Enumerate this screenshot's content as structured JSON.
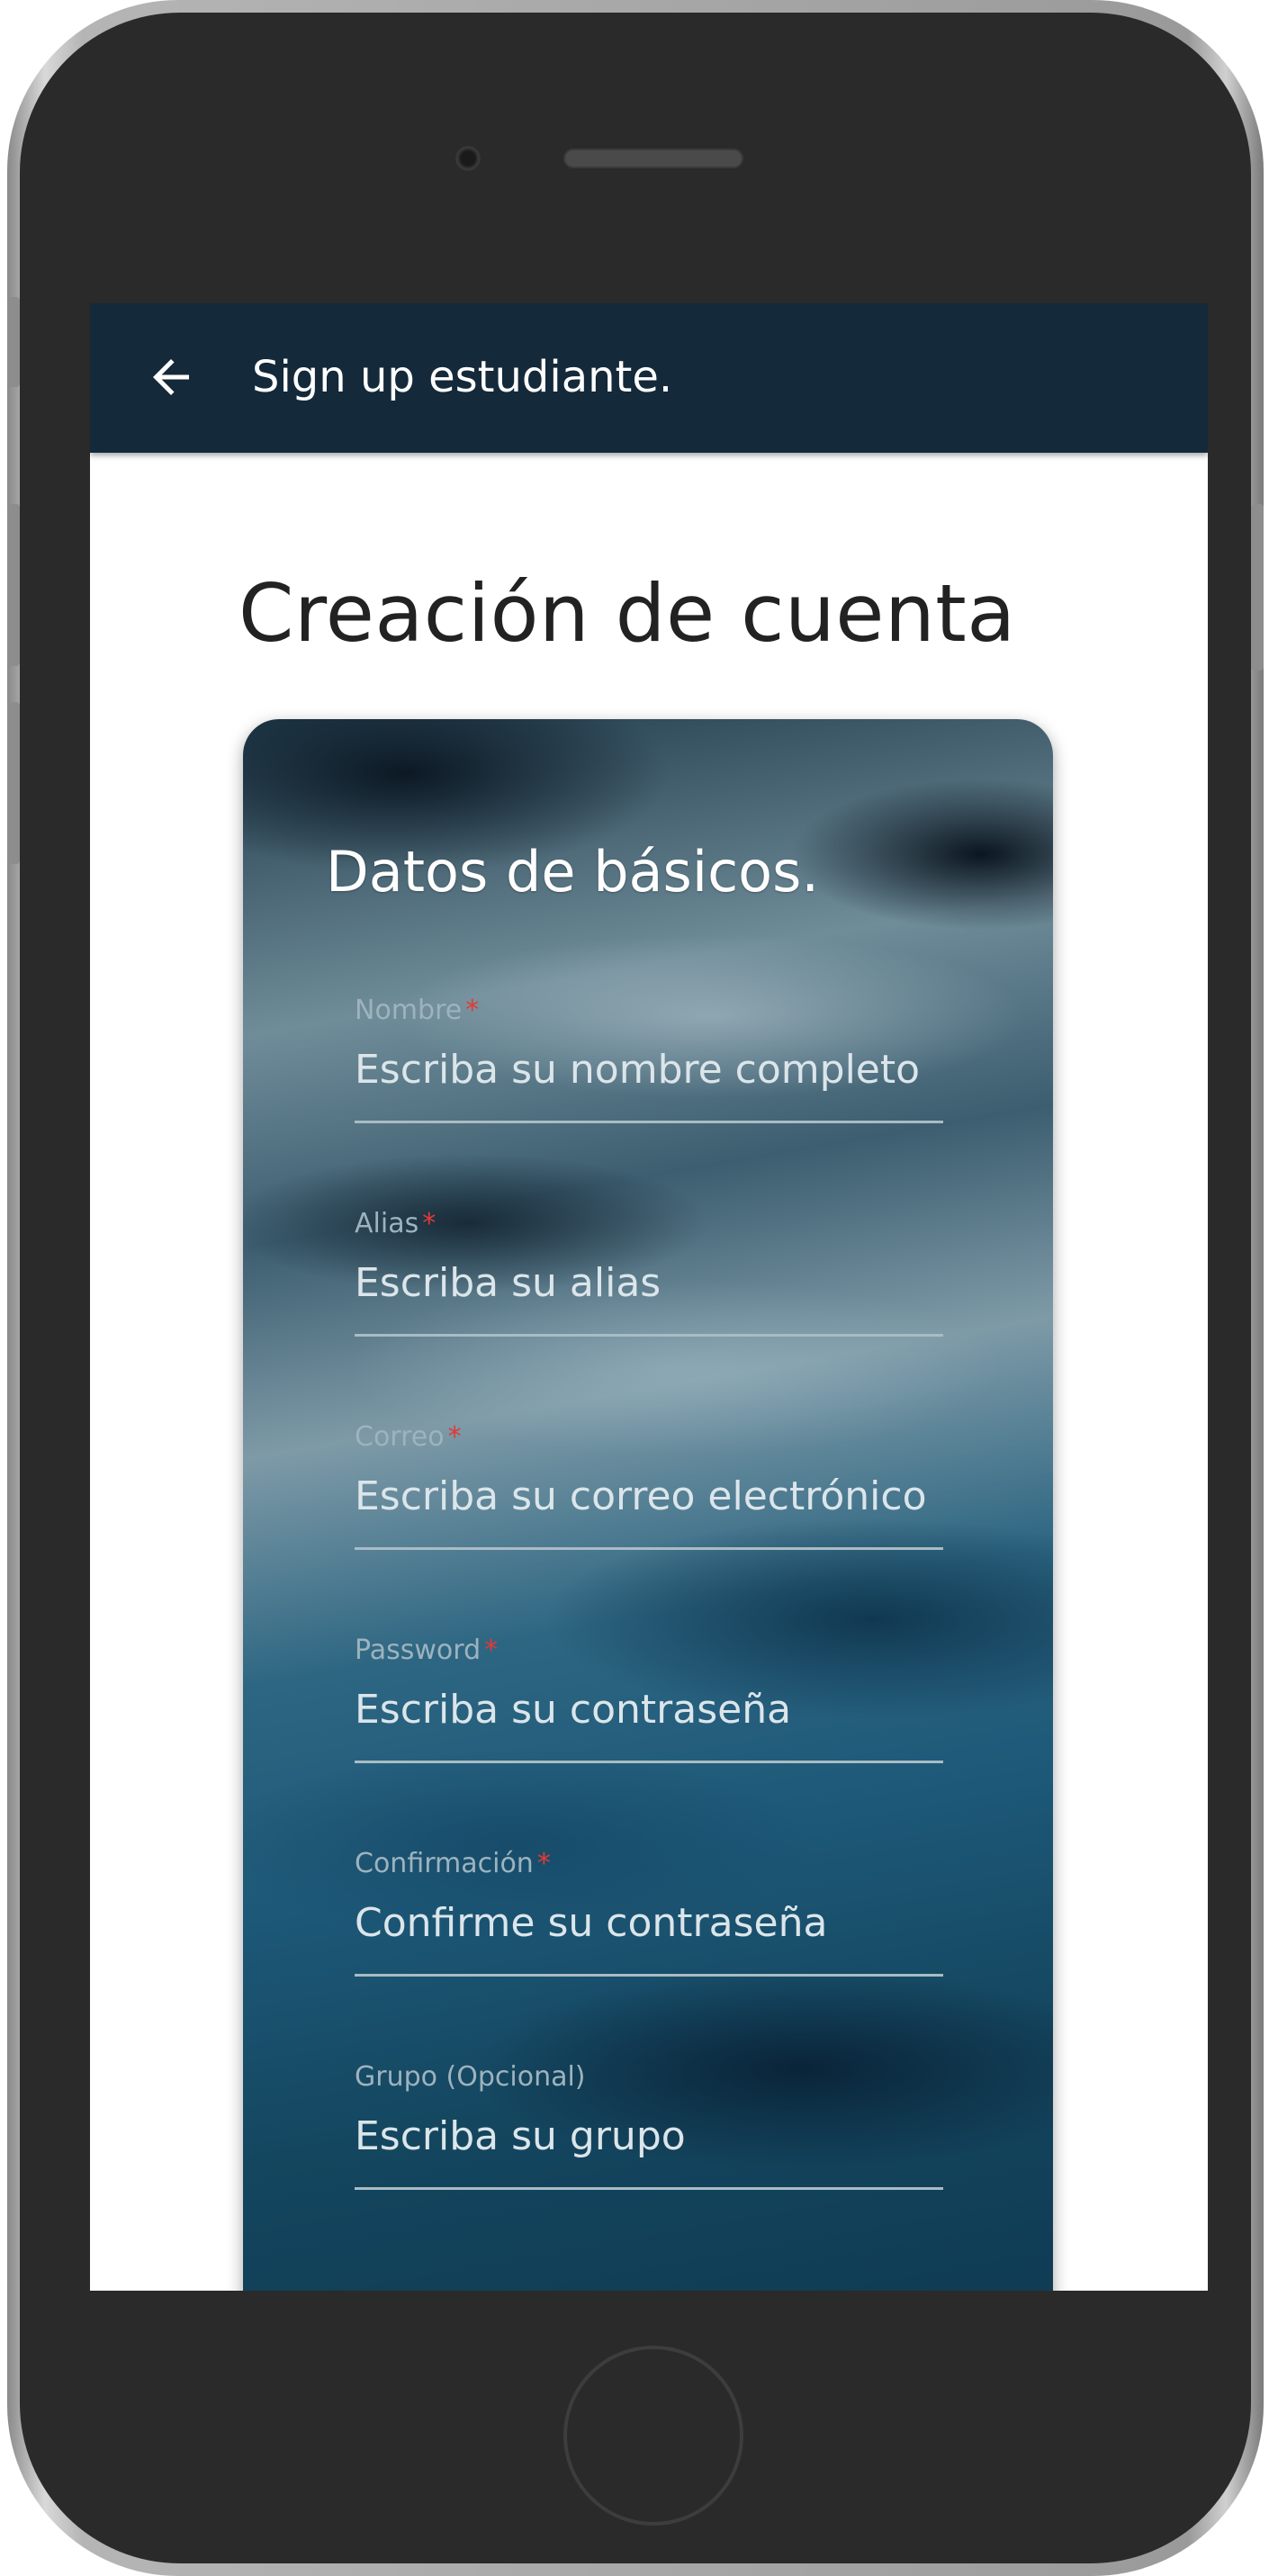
{
  "appbar": {
    "title": "Sign up estudiante."
  },
  "page": {
    "title": "Creación de cuenta"
  },
  "card": {
    "title": "Datos de básicos.",
    "fields": [
      {
        "label": "Nombre",
        "required": "*",
        "placeholder": "Escriba su nombre completo"
      },
      {
        "label": "Alias",
        "required": "*",
        "placeholder": "Escriba su alias"
      },
      {
        "label": "Correo",
        "required": "*",
        "placeholder": "Escriba su correo electrónico"
      },
      {
        "label": "Password",
        "required": "*",
        "placeholder": "Escriba su contraseña"
      },
      {
        "label": "Confirmación",
        "required": "*",
        "placeholder": "Confirme su contraseña"
      },
      {
        "label": "Grupo (Opcional)",
        "required": "",
        "placeholder": "Escriba su grupo"
      }
    ]
  },
  "icons": {
    "back": "arrow-left-icon"
  },
  "colors": {
    "appbar": "#14293a",
    "required": "#e53935"
  }
}
